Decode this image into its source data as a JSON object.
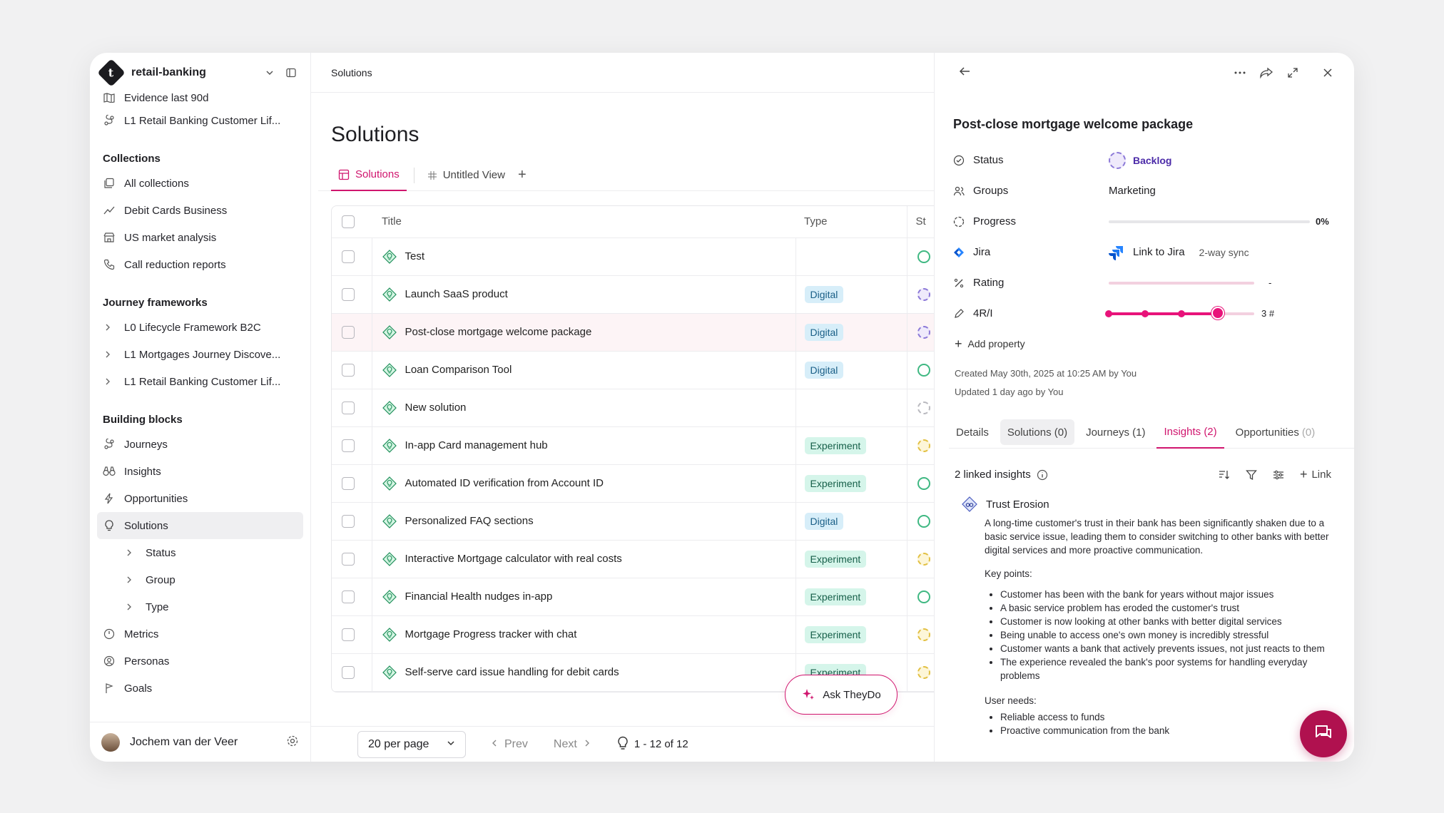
{
  "workspace": {
    "name": "retail-banking"
  },
  "sidebar": {
    "top_items": [
      "Evidence last 90d",
      "L1 Retail Banking Customer Lif..."
    ],
    "collections": {
      "title": "Collections",
      "items": [
        "All collections",
        "Debit Cards Business",
        "US market analysis",
        "Call reduction reports"
      ]
    },
    "frameworks": {
      "title": "Journey frameworks",
      "items": [
        "L0 Lifecycle Framework B2C",
        "L1 Mortgages Journey Discove...",
        "L1 Retail Banking Customer Lif..."
      ]
    },
    "blocks": {
      "title": "Building blocks",
      "items": [
        "Journeys",
        "Insights",
        "Opportunities",
        "Solutions"
      ],
      "solution_children": [
        "Status",
        "Group",
        "Type"
      ],
      "more": [
        "Metrics",
        "Personas",
        "Goals"
      ]
    },
    "user": "Jochem van der Veer"
  },
  "main": {
    "breadcrumb": "Solutions",
    "title": "Solutions",
    "views": [
      "Solutions",
      "Untitled View"
    ],
    "columns": [
      "Title",
      "Type",
      "St"
    ],
    "rows": [
      {
        "title": "Test",
        "type": "",
        "status": "green"
      },
      {
        "title": "Launch SaaS product",
        "type": "Digital",
        "status": "purple"
      },
      {
        "title": "Post-close mortgage welcome package",
        "type": "Digital",
        "status": "purple"
      },
      {
        "title": "Loan Comparison Tool",
        "type": "Digital",
        "status": "green"
      },
      {
        "title": "New solution",
        "type": "",
        "status": "grey"
      },
      {
        "title": "In-app Card management hub",
        "type": "Experiment",
        "status": "yellow"
      },
      {
        "title": "Automated ID verification from Account ID",
        "type": "Experiment",
        "status": "green"
      },
      {
        "title": "Personalized FAQ sections",
        "type": "Digital",
        "status": "green"
      },
      {
        "title": "Interactive Mortgage calculator with real costs",
        "type": "Experiment",
        "status": "yellow"
      },
      {
        "title": "Financial Health nudges in-app",
        "type": "Experiment",
        "status": "green"
      },
      {
        "title": "Mortgage Progress tracker with chat",
        "type": "Experiment",
        "status": "yellow"
      },
      {
        "title": "Self-serve card issue handling for debit cards",
        "type": "Experiment",
        "status": "yellow"
      }
    ],
    "ask_label": "Ask TheyDo",
    "pager": {
      "per_page": "20 per page",
      "prev": "Prev",
      "next": "Next",
      "count": "1 - 12 of 12"
    }
  },
  "detail": {
    "title": "Post-close mortgage welcome package",
    "props": {
      "status_label": "Status",
      "status_value": "Backlog",
      "groups_label": "Groups",
      "groups_value": "Marketing",
      "progress_label": "Progress",
      "progress_value": "0%",
      "progress_fraction": 0,
      "jira_label": "Jira",
      "jira_link": "Link to Jira",
      "jira_sync": "2-way sync",
      "rating_label": "Rating",
      "rating_value": "-",
      "rri_label": "4R/I",
      "rri_value": "3 #",
      "rri_level": 3,
      "rri_max": 4,
      "add_property": "Add property"
    },
    "created": "Created May 30th, 2025 at 10:25 AM by You",
    "updated": "Updated 1 day ago by You",
    "tabs": {
      "details": "Details",
      "solutions": "Solutions (0)",
      "journeys": "Journeys (1)",
      "insights": "Insights (2)",
      "opportunities": "Opportunities",
      "opportunities_count": "(0)"
    },
    "insights": {
      "count_label": "2 linked insights",
      "link_label": "Link",
      "item_title": "Trust Erosion",
      "description": "A long-time customer's trust in their bank has been significantly shaken due to a basic service issue, leading them to consider switching to other banks with better digital services and more proactive communication.",
      "key_points_label": "Key points:",
      "key_points": [
        "Customer has been with the bank for years without major issues",
        "A basic service problem has eroded the customer's trust",
        "Customer is now looking at other banks with better digital services",
        "Being unable to access one's own money is incredibly stressful",
        "Customer wants a bank that actively prevents issues, not just reacts to them",
        "The experience revealed the bank's poor systems for handling everyday problems"
      ],
      "user_needs_label": "User needs:",
      "user_needs": [
        "Reliable access to funds",
        "Proactive communication from the bank"
      ]
    }
  }
}
